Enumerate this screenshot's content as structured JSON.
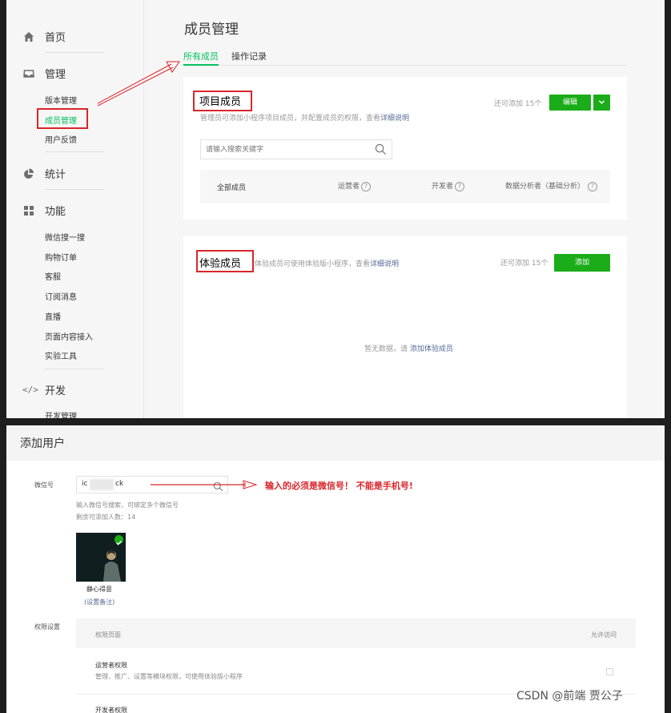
{
  "sidebar": {
    "home": "首页",
    "manage": "管理",
    "manage_items": [
      "版本管理",
      "成员管理",
      "用户反馈"
    ],
    "stats": "统计",
    "features": "功能",
    "feature_items": [
      "微信搜一搜",
      "购物订单",
      "客服",
      "订阅消息",
      "直播",
      "页面内容接入",
      "实验工具"
    ],
    "dev": "开发",
    "dev_items": [
      "开发管理"
    ]
  },
  "main": {
    "title": "成员管理",
    "tabs": [
      "所有成员",
      "操作记录"
    ],
    "project": {
      "title": "项目成员",
      "desc": "管理员可添加小程序项目成员，并配置成员的权限，查看",
      "desc_link": "详细说明",
      "remaining": "还可添加 15个",
      "edit_button": "编辑",
      "search_placeholder": "请输入搜索关键字",
      "filters": [
        "全部成员",
        "运营者",
        "开发者",
        "数据分析者（基础分析）"
      ]
    },
    "trial": {
      "title": "体验成员",
      "desc": "体验成员可使用体验版小程序，查看",
      "desc_link": "详细说明",
      "remaining": "还可添加 15个",
      "add_button": "添加",
      "empty_text": "暂无数据，请",
      "empty_link": "添加体验成员"
    }
  },
  "add_user": {
    "title": "添加用户",
    "wechat_label": "微信号",
    "wechat_value_start": "ic",
    "wechat_value_end": "ck",
    "annotation": "输入的必须是微信号！ 不能是手机号!",
    "hint": "输入微信号搜索，可绑定多个微信号",
    "remaining": "剩余可添加人数：14",
    "user_name": "静心得意",
    "set_remark": "(设置备注)",
    "perm_label": "权限设置",
    "perm_header_left": "权限页面",
    "perm_header_right": "允许访问",
    "perm_operator_title": "运营者权限",
    "perm_operator_desc": "管理、推广、设置等模块权限，可使用体验版小程序",
    "perm_developer_title": "开发者权限"
  },
  "watermark": "CSDN @前端 贾公子",
  "colors": {
    "brand_green": "#07c160",
    "button_green": "#1aad19",
    "annotation_red": "#d9262b",
    "link_blue": "#576b95"
  }
}
